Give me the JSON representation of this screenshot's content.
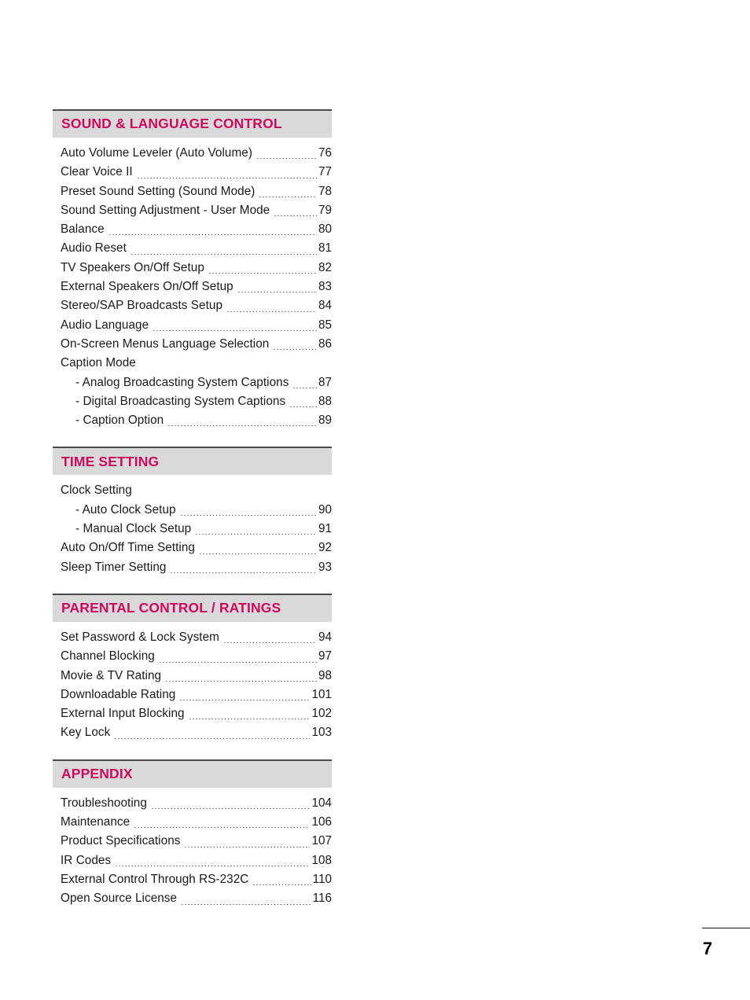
{
  "document": {
    "page_number": "7",
    "accent_color": "#cc0b5c",
    "header_band_color": "#d9d9d9",
    "header_rule_color": "#4a4a4a"
  },
  "sections": [
    {
      "title": "SOUND & LANGUAGE CONTROL",
      "entries": [
        {
          "label": "Auto Volume Leveler (Auto Volume)",
          "page": "76",
          "sub": false
        },
        {
          "label": "Clear Voice II",
          "page": "77",
          "sub": false
        },
        {
          "label": "Preset Sound Setting (Sound Mode)",
          "page": "78",
          "sub": false
        },
        {
          "label": "Sound Setting Adjustment - User Mode",
          "page": "79",
          "sub": false
        },
        {
          "label": "Balance",
          "page": "80",
          "sub": false
        },
        {
          "label": "Audio Reset",
          "page": "81",
          "sub": false
        },
        {
          "label": "TV Speakers On/Off Setup",
          "page": "82",
          "sub": false
        },
        {
          "label": "External Speakers On/Off Setup",
          "page": "83",
          "sub": false
        },
        {
          "label": "Stereo/SAP Broadcasts Setup",
          "page": "84",
          "sub": false
        },
        {
          "label": "Audio Language",
          "page": "85",
          "sub": false
        },
        {
          "label": "On-Screen Menus Language Selection",
          "page": "86",
          "sub": false
        },
        {
          "label": "Caption Mode",
          "page": "",
          "sub": false
        },
        {
          "label": "- Analog Broadcasting System Captions",
          "page": "87",
          "sub": true
        },
        {
          "label": "- Digital Broadcasting System Captions",
          "page": "88",
          "sub": true
        },
        {
          "label": "- Caption Option",
          "page": "89",
          "sub": true
        }
      ]
    },
    {
      "title": "TIME SETTING",
      "entries": [
        {
          "label": "Clock Setting",
          "page": "",
          "sub": false
        },
        {
          "label": "- Auto Clock Setup",
          "page": "90",
          "sub": true
        },
        {
          "label": "- Manual Clock Setup",
          "page": "91",
          "sub": true
        },
        {
          "label": "Auto On/Off Time Setting",
          "page": "92",
          "sub": false
        },
        {
          "label": "Sleep Timer Setting",
          "page": "93",
          "sub": false
        }
      ]
    },
    {
      "title": "PARENTAL CONTROL / RATINGS",
      "entries": [
        {
          "label": "Set Password & Lock System",
          "page": "94",
          "sub": false
        },
        {
          "label": "Channel Blocking",
          "page": "97",
          "sub": false
        },
        {
          "label": "Movie & TV Rating",
          "page": "98",
          "sub": false
        },
        {
          "label": "Downloadable Rating",
          "page": "101",
          "sub": false
        },
        {
          "label": "External Input Blocking",
          "page": "102",
          "sub": false
        },
        {
          "label": "Key Lock",
          "page": "103",
          "sub": false
        }
      ]
    },
    {
      "title": "APPENDIX",
      "entries": [
        {
          "label": "Troubleshooting",
          "page": "104",
          "sub": false
        },
        {
          "label": "Maintenance",
          "page": "106",
          "sub": false
        },
        {
          "label": "Product Specifications",
          "page": "107",
          "sub": false
        },
        {
          "label": "IR Codes",
          "page": "108",
          "sub": false
        },
        {
          "label": "External Control Through RS-232C",
          "page": "110",
          "sub": false
        },
        {
          "label": "Open Source License",
          "page": "116",
          "sub": false
        }
      ]
    }
  ]
}
